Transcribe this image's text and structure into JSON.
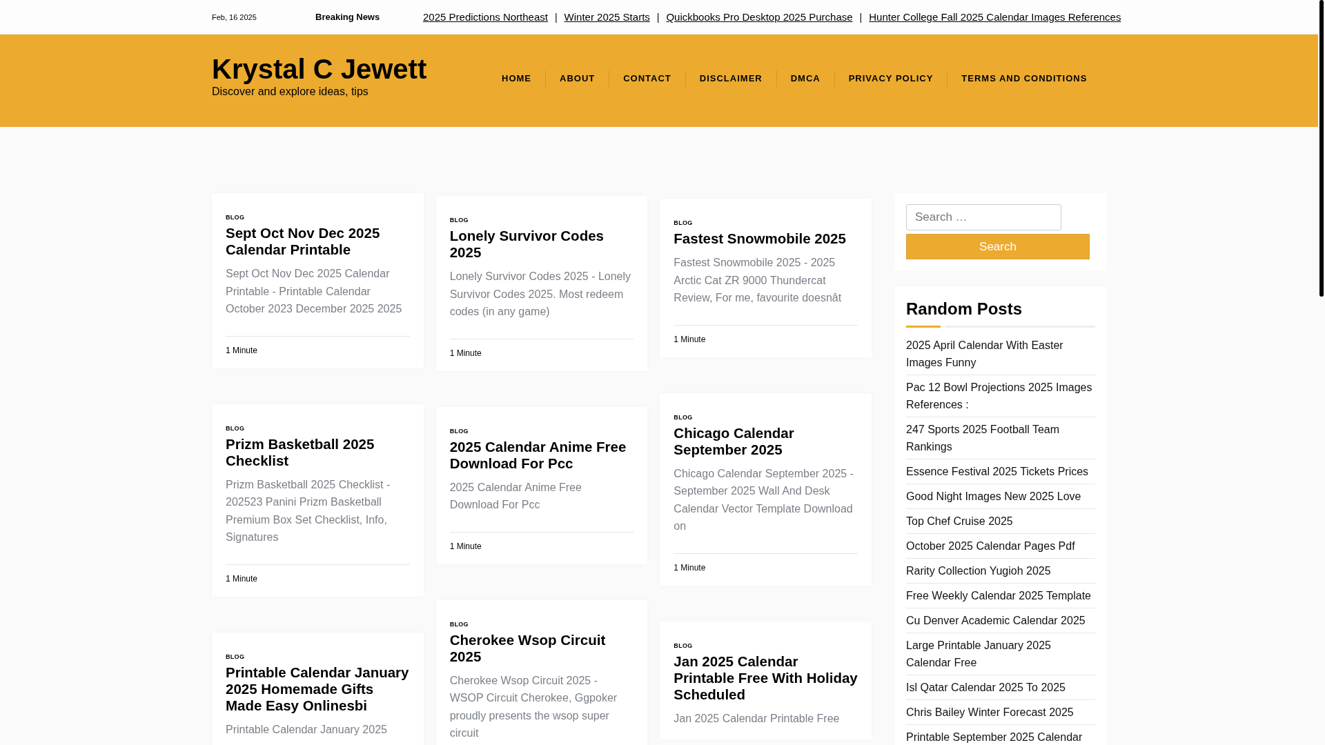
{
  "top_bar": {
    "date": "Feb, 16 2025",
    "breaking_label": "Breaking News",
    "ticker": [
      "2025 Predictions Northeast",
      "Winter 2025 Starts",
      "Quickbooks Pro Desktop 2025 Purchase",
      "Hunter College Fall 2025 Calendar Images References"
    ],
    "separator": "|"
  },
  "header": {
    "site_title": "Krystal C Jewett",
    "tagline": "Discover and explore ideas, tips",
    "nav": [
      "HOME",
      "ABOUT",
      "CONTACT",
      "DISCLAIMER",
      "DMCA",
      "PRIVACY POLICY",
      "TERMS AND CONDITIONS"
    ]
  },
  "columns": [
    [
      {
        "category": "BLOG",
        "title": "Sept Oct Nov Dec 2025 Calendar Printable",
        "excerpt": "Sept Oct Nov Dec 2025 Calendar Printable - Printable Calendar October 2023 December 2025 2025",
        "read_time": "1 Minute"
      },
      {
        "category": "BLOG",
        "title": "Prizm Basketball 2025 Checklist",
        "excerpt": "Prizm Basketball 2025 Checklist - 202523 Panini Prizm Basketball Premium Box Set Checklist, Info, Signatures",
        "read_time": "1 Minute"
      },
      {
        "category": "BLOG",
        "title": "Printable Calendar January 2025 Homemade Gifts Made Easy Onlinesbi",
        "excerpt": "Printable Calendar January 2025"
      }
    ],
    [
      {
        "category": "BLOG",
        "title": "Lonely Survivor Codes 2025",
        "excerpt": "Lonely Survivor Codes 2025 - Lonely Survivor Codes 2025. Most redeem codes (in any game)",
        "read_time": "1 Minute"
      },
      {
        "category": "BLOG",
        "title": "2025 Calendar Anime Free Download For Pcc",
        "excerpt": "2025 Calendar Anime Free Download For Pcc",
        "read_time": "1 Minute"
      },
      {
        "category": "BLOG",
        "title": "Cherokee Wsop Circuit 2025",
        "excerpt": "Cherokee Wsop Circuit 2025 - WSOP Circuit Cherokee, Ggpoker proudly presents the wsop super circuit"
      }
    ],
    [
      {
        "category": "BLOG",
        "title": "Fastest Snowmobile 2025",
        "excerpt": "Fastest Snowmobile 2025 - 2025 Arctic Cat ZR 9000 Thundercat Review, For me, favourite doesnât",
        "read_time": "1 Minute"
      },
      {
        "category": "BLOG",
        "title": "Chicago Calendar September 2025",
        "excerpt": "Chicago Calendar September 2025 - September 2025 Wall And Desk Calendar Vector Template Download on",
        "read_time": "1 Minute"
      },
      {
        "category": "BLOG",
        "title": "Jan 2025 Calendar Printable Free With Holiday Scheduled",
        "excerpt": "Jan 2025 Calendar Printable Free"
      }
    ]
  ],
  "sidebar": {
    "search": {
      "placeholder": "Search …",
      "button": "Search"
    },
    "random_posts": {
      "heading": "Random Posts",
      "items": [
        "2025 April Calendar With Easter Images Funny",
        "Pac 12 Bowl Projections 2025 Images References :",
        "247 Sports 2025 Football Team Rankings",
        "Essence Festival 2025 Tickets Prices",
        "Good Night Images New 2025 Love",
        "Top Chef Cruise 2025",
        "October 2025 Calendar Pages Pdf",
        "Rarity Collection Yugioh 2025",
        "Free Weekly Calendar 2025 Template",
        "Cu Denver Academic Calendar 2025",
        "Large Printable January 2025 Calendar Free",
        "Isl Qatar Calendar 2025 To 2025",
        "Chris Bailey Winter Forecast 2025",
        "Printable September 2025 Calendar"
      ]
    }
  }
}
